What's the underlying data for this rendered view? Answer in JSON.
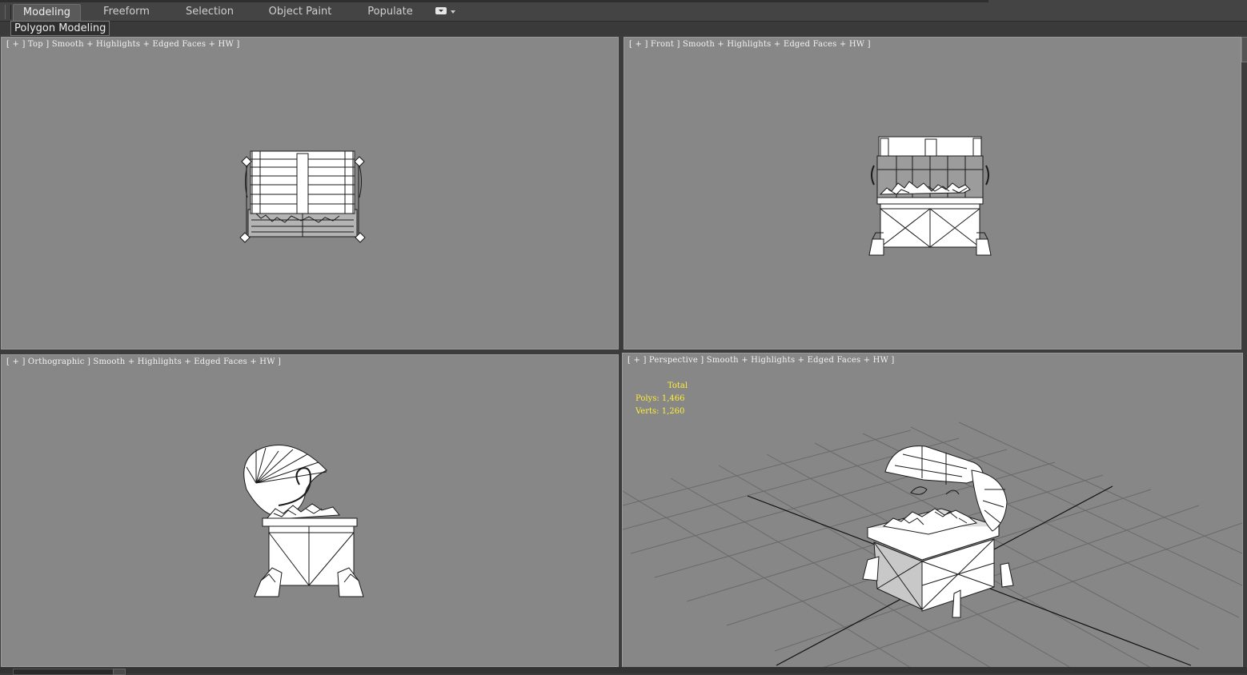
{
  "ribbon": {
    "tabs": [
      {
        "label": "Modeling",
        "active": true
      },
      {
        "label": "Freeform",
        "active": false
      },
      {
        "label": "Selection",
        "active": false
      },
      {
        "label": "Object Paint",
        "active": false
      },
      {
        "label": "Populate",
        "active": false
      }
    ],
    "panel_label": "Polygon Modeling"
  },
  "viewports": {
    "top": {
      "label": "[ + ] Top ] Smooth + Highlights + Edged Faces + HW ]"
    },
    "front": {
      "label": "[ + ] Front ] Smooth + Highlights + Edged Faces + HW ]"
    },
    "ortho": {
      "label": "[ + ] Orthographic ] Smooth + Highlights + Edged Faces + HW ]"
    },
    "persp": {
      "label": "[ + ] Perspective ] Smooth + Highlights + Edged Faces + HW ]",
      "stats": {
        "title": "Total",
        "polys": "Polys: 1,466",
        "verts": "Verts: 1,260"
      }
    }
  },
  "colors": {
    "viewport_bg": "#878787",
    "stats_text": "#ffee33",
    "wire": "#1a1a1a"
  }
}
